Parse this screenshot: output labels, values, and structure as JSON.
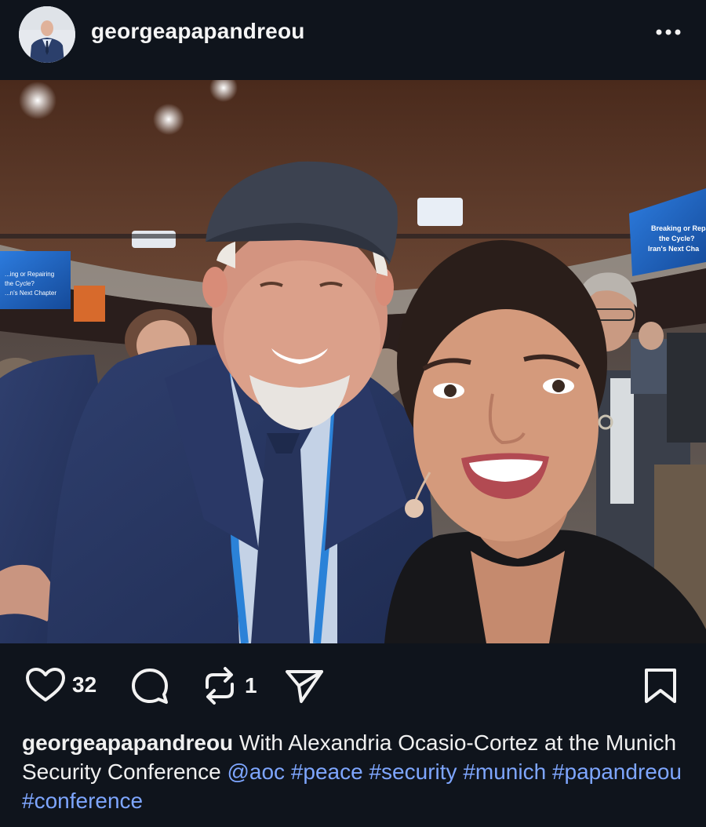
{
  "post": {
    "username": "georgeapapandreou",
    "likes": "32",
    "reposts": "1",
    "caption": {
      "username": "georgeapapandreou",
      "text": "With Alexandria Ocasio-Cortez at the Munich Security Conference",
      "tags": [
        "@aoc",
        "#peace",
        "#security",
        "#munich",
        "#papandreou",
        "#conference"
      ]
    }
  },
  "photo": {
    "screen_left": {
      "lines": [
        "...ing or Repairing",
        "the Cycle?",
        "...n's Next Chapter"
      ]
    },
    "screen_right": {
      "lines": [
        "Breaking or Repa",
        "the Cycle?",
        "Iran's Next Cha"
      ]
    }
  },
  "colors": {
    "background": "#0f141c",
    "text": "#f3f3f3",
    "link": "#7ea6ff",
    "screen_blue": "#1d5fb0"
  },
  "icons": {
    "more": "more-horizontal-icon",
    "like": "heart-icon",
    "comment": "comment-icon",
    "repost": "repost-icon",
    "share": "send-icon",
    "save": "bookmark-icon"
  }
}
